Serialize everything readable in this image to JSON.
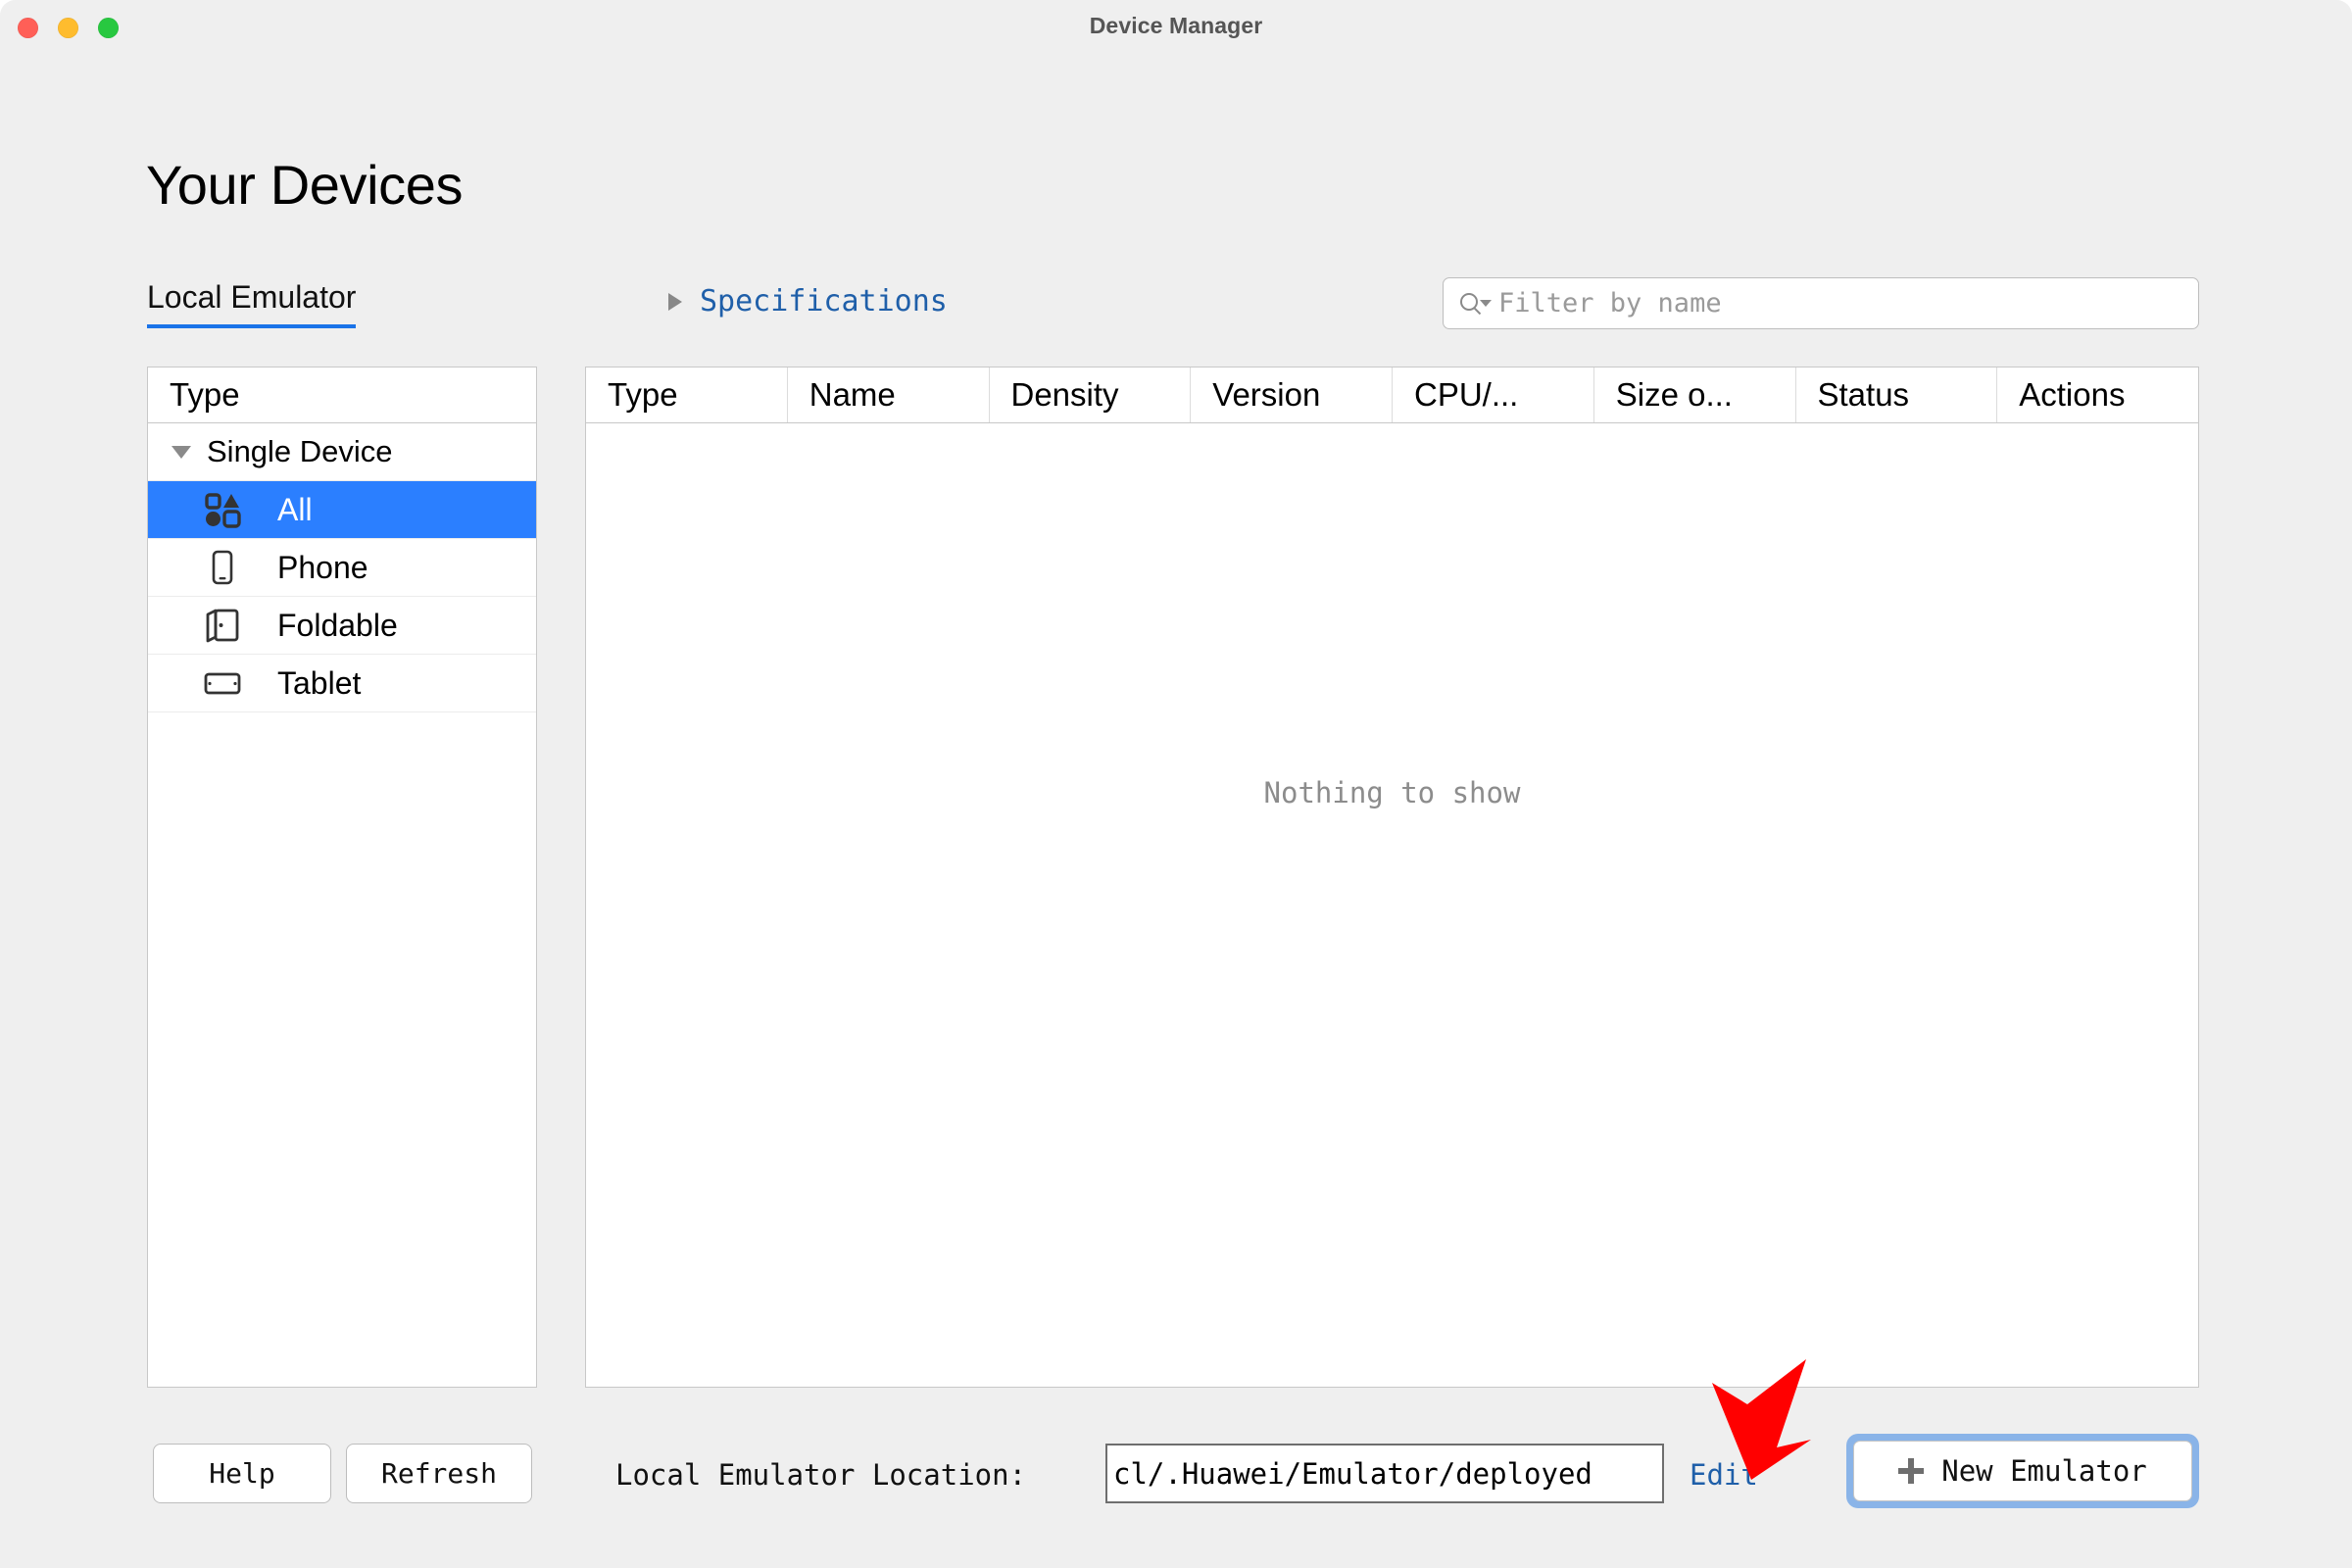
{
  "window": {
    "title": "Device Manager",
    "traffic_lights": [
      {
        "name": "close",
        "color": "#ff5f57"
      },
      {
        "name": "minimize",
        "color": "#febc2e"
      },
      {
        "name": "maximize",
        "color": "#28c840"
      }
    ]
  },
  "page": {
    "heading": "Your Devices"
  },
  "tabs": [
    {
      "label": "Local Emulator",
      "active": true
    }
  ],
  "specifications": {
    "label": "Specifications",
    "expanded": false,
    "icon": "triangle-right-icon",
    "color": "#1f5fa9"
  },
  "search": {
    "icon": "search-icon",
    "placeholder": "Filter by name",
    "value": ""
  },
  "type_panel": {
    "header": "Type",
    "tree": [
      {
        "label": "Single Device",
        "level": "group",
        "expanded": true,
        "icon": "caret-down-icon"
      },
      {
        "label": "All",
        "level": "child",
        "icon": "all-devices-icon",
        "selected": true
      },
      {
        "label": "Phone",
        "level": "child",
        "icon": "phone-icon",
        "selected": false
      },
      {
        "label": "Foldable",
        "level": "child",
        "icon": "foldable-icon",
        "selected": false
      },
      {
        "label": "Tablet",
        "level": "child",
        "icon": "tablet-icon",
        "selected": false
      }
    ]
  },
  "table": {
    "columns": [
      "Type",
      "Name",
      "Density",
      "Version",
      "CPU/...",
      "Size o...",
      "Status",
      "Actions"
    ],
    "rows": [],
    "empty_message": "Nothing to show"
  },
  "footer": {
    "help_label": "Help",
    "refresh_label": "Refresh",
    "location_label": "Local Emulator Location:",
    "location_value": "cl/.Huawei/Emulator/deployed",
    "edit_label": "Edit",
    "new_emulator_label": "New Emulator",
    "new_emulator_icon": "plus-icon"
  },
  "annotation": {
    "arrow": "red-arrow-pointing-down-left",
    "color": "#ff0000",
    "target": "Edit"
  },
  "colors": {
    "accent": "#2b7fff",
    "link": "#1f5fa9",
    "tab_underline": "#1a73e8",
    "window_bg": "#efefef",
    "focus_ring": "#8ab4e8"
  }
}
